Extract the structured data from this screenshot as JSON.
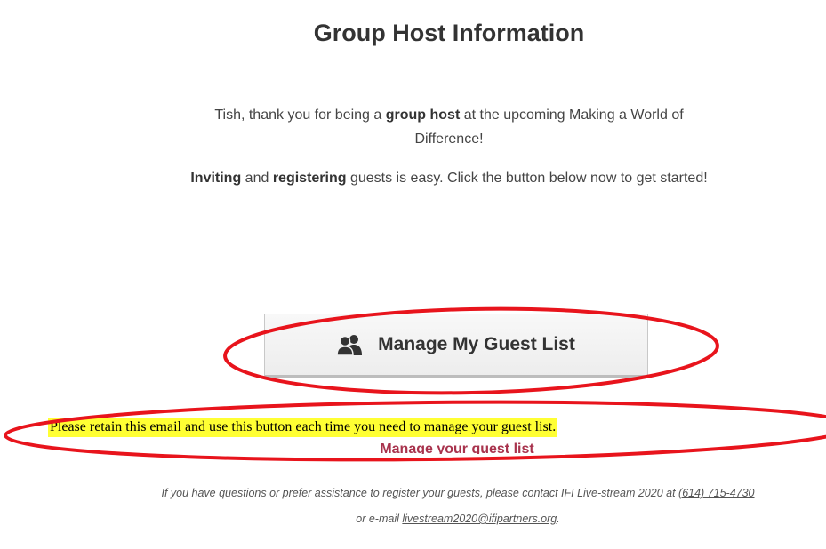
{
  "header": {
    "title": "Group Host Information"
  },
  "intro": {
    "line1_pre": "Tish, thank you for being a ",
    "line1_bold": "group host",
    "line1_post": " at the upcoming Making a World of Difference!",
    "line2_bold1": "Inviting",
    "line2_mid": " and ",
    "line2_bold2": "registering",
    "line2_post": " guests is easy. Click the button below now to get started!"
  },
  "button": {
    "label": "Manage My Guest List",
    "icon": "group-users-icon"
  },
  "obscured_text": "Manage your guest list",
  "annotation": {
    "note": "Please retain this email and use this button each time you need to manage your guest list.",
    "highlight_color": "#ffff33",
    "oval_color": "#e8141c"
  },
  "footer": {
    "line_pre": "If you have questions or prefer assistance to register your guests, please contact IFI Live-stream 2020 at ",
    "phone": "(614) 715-4730",
    "line_mid": " or e-mail ",
    "email": "livestream2020@ifipartners.org",
    "line_end": "."
  }
}
